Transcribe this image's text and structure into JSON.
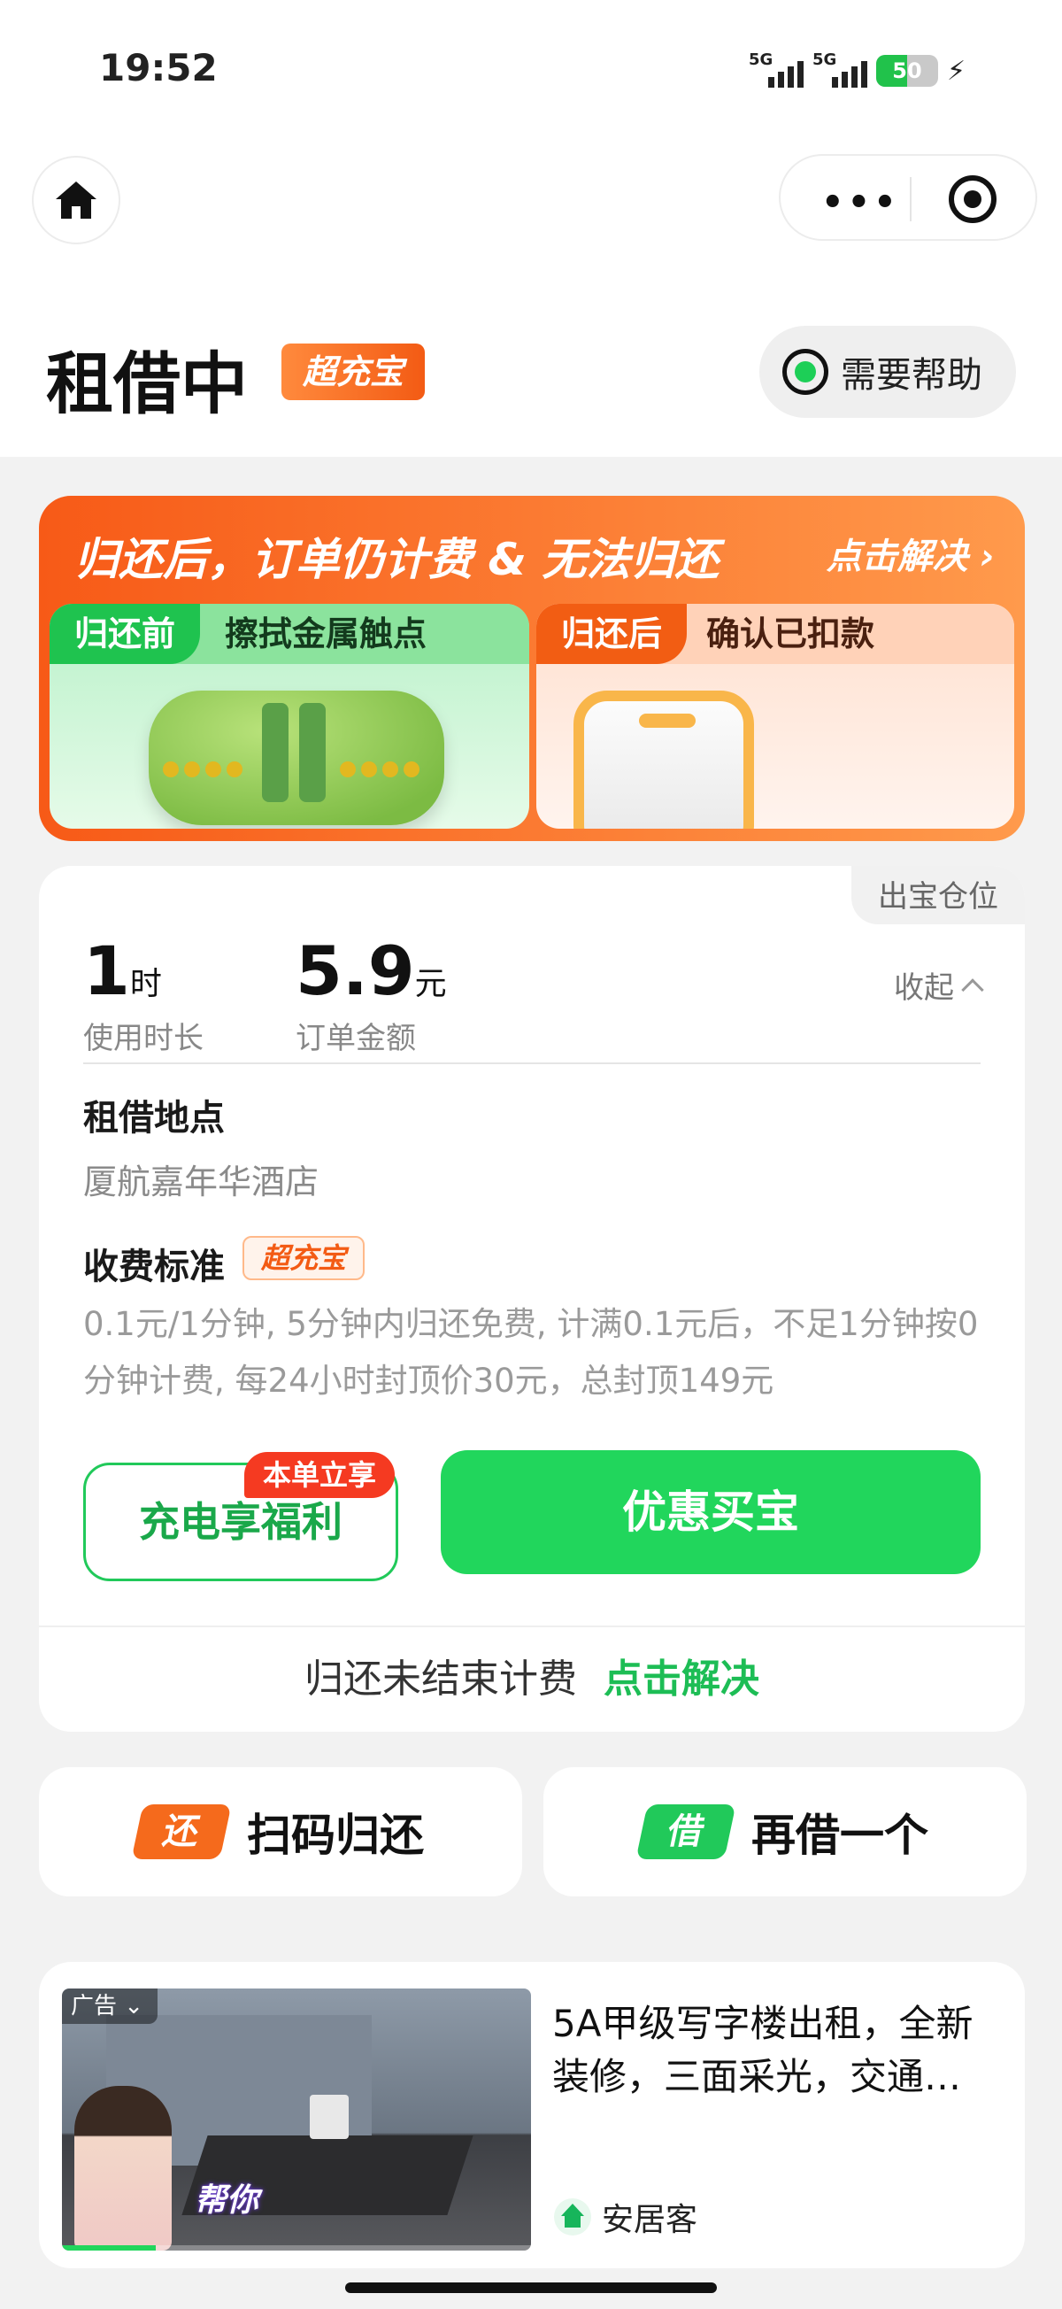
{
  "status_bar": {
    "time": "19:52",
    "network1": "5G",
    "network2": "5G",
    "battery": "50",
    "battery_level": 0.5
  },
  "nav": {
    "home_icon": "home-icon",
    "more_icon": "more-dots-icon",
    "close_icon": "target-icon"
  },
  "header": {
    "title": "租借中",
    "brand_badge": "超充宝",
    "help_label": "需要帮助"
  },
  "banner": {
    "title": "归还后，订单仍计费 & 无法归还",
    "link": "点击解决",
    "left_tag": "归还前",
    "left_title": "擦拭金属触点",
    "right_tag": "归还后",
    "right_title": "确认已扣款"
  },
  "order": {
    "slot_tag": "出宝仓位",
    "duration_value": "1",
    "duration_unit": "时",
    "duration_label": "使用时长",
    "amount_value": "5.9",
    "amount_unit": "元",
    "amount_label": "订单金额",
    "collapse_label": "收起",
    "location_title": "租借地点",
    "location_value": "厦航嘉年华酒店",
    "fee_title": "收费标准",
    "fee_badge": "超充宝",
    "fee_text": "0.1元/1分钟, 5分钟内归还免费, 计满0.1元后，不足1分钟按0分钟计费, 每24小时封顶价30元，总封顶149元",
    "benefit_button": "充电享福利",
    "benefit_tag": "本单立享",
    "buy_button": "优惠买宝",
    "return_text": "归还未结束计费",
    "return_link": "点击解决"
  },
  "actions": {
    "return_icon_text": "还",
    "return_label": "扫码归还",
    "borrow_icon_text": "借",
    "borrow_label": "再借一个"
  },
  "ad": {
    "ad_label": "广告",
    "title": "5A甲级写字楼出租，全新装修，三面采光，交通…",
    "overlay_text": "帮你",
    "source": "安居客",
    "progress": 0.2
  },
  "colors": {
    "green": "#21d65c",
    "orange": "#f35b14"
  }
}
